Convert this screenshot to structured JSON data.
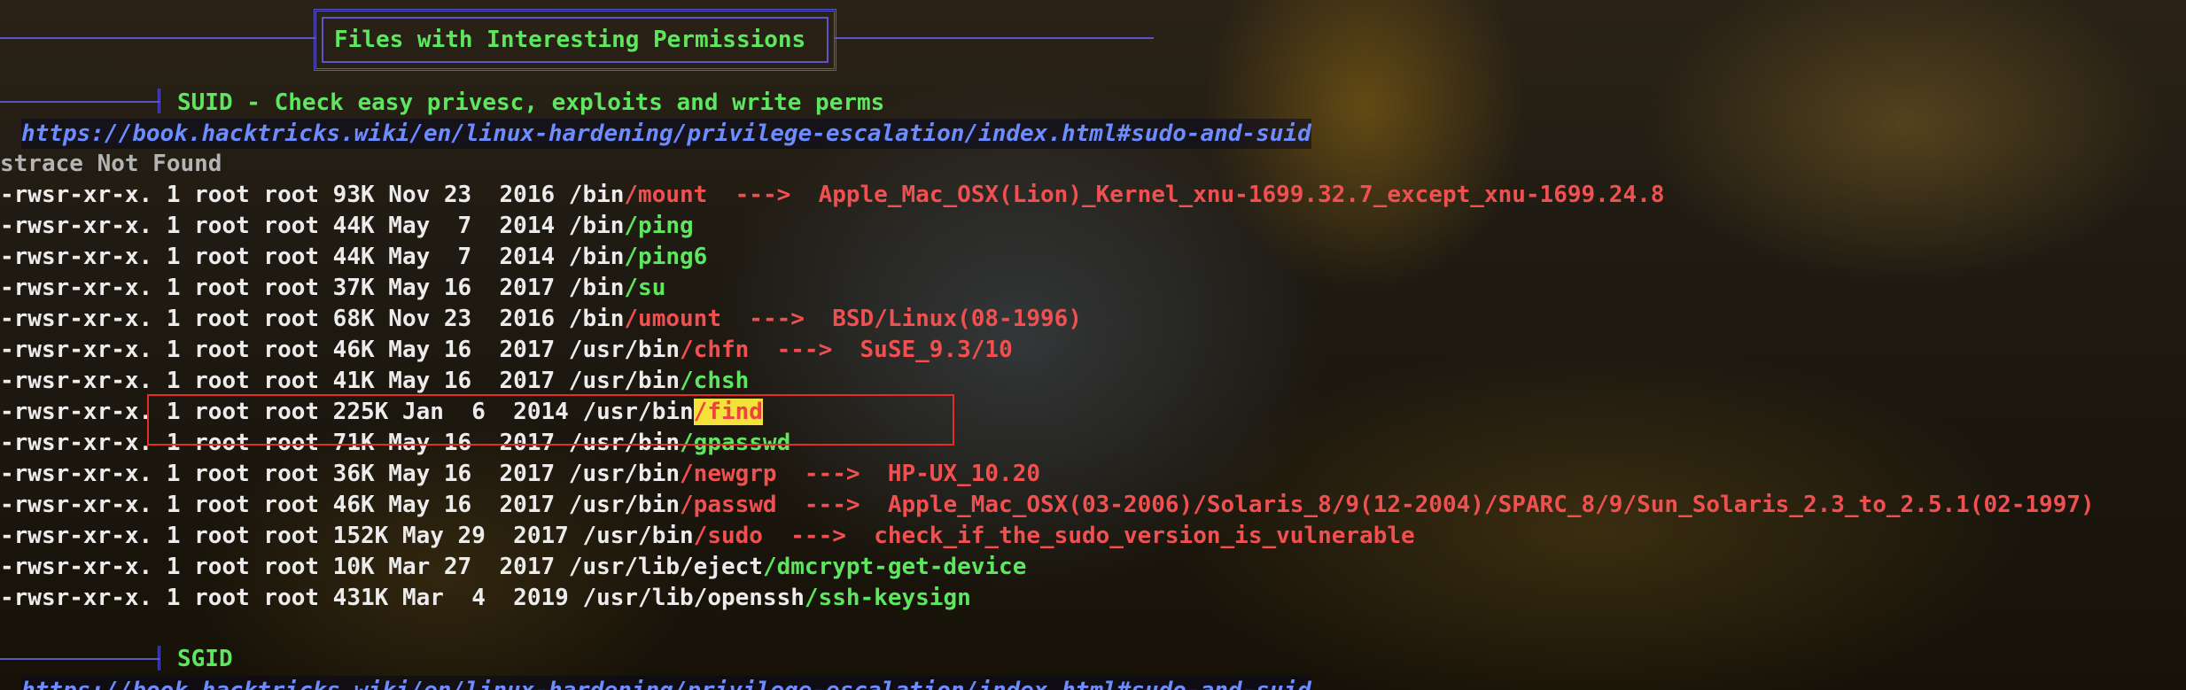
{
  "header": {
    "title": "Files with Interesting Permissions"
  },
  "suid": {
    "heading": "SUID - Check easy privesc, exploits and write perms",
    "link": "https://book.hacktricks.wiki/en/linux-hardening/privilege-escalation/index.html#sudo-and-suid",
    "status": "strace Not Found",
    "rows": [
      {
        "meta": "-rwsr-xr-x. 1 root root 93K Nov 23  2016 /bin",
        "file": "/mount",
        "file_color": "red",
        "arrow": "  --->  ",
        "note": "Apple_Mac_OSX(Lion)_Kernel_xnu-1699.32.7_except_xnu-1699.24.8"
      },
      {
        "meta": "-rwsr-xr-x. 1 root root 44K May  7  2014 /bin",
        "file": "/ping",
        "file_color": "green",
        "arrow": "",
        "note": ""
      },
      {
        "meta": "-rwsr-xr-x. 1 root root 44K May  7  2014 /bin",
        "file": "/ping6",
        "file_color": "green",
        "arrow": "",
        "note": ""
      },
      {
        "meta": "-rwsr-xr-x. 1 root root 37K May 16  2017 /bin",
        "file": "/su",
        "file_color": "green",
        "arrow": "",
        "note": ""
      },
      {
        "meta": "-rwsr-xr-x. 1 root root 68K Nov 23  2016 /bin",
        "file": "/umount",
        "file_color": "red",
        "arrow": "  --->  ",
        "note": "BSD/Linux(08-1996)"
      },
      {
        "meta": "-rwsr-xr-x. 1 root root 46K May 16  2017 /usr/bin",
        "file": "/chfn",
        "file_color": "red",
        "arrow": "  --->  ",
        "note": "SuSE_9.3/10"
      },
      {
        "meta": "-rwsr-xr-x. 1 root root 41K May 16  2017 /usr/bin",
        "file": "/chsh",
        "file_color": "green",
        "arrow": "",
        "note": ""
      },
      {
        "meta": "-rwsr-xr-x. 1 root root 225K Jan  6  2014 /usr/bin",
        "file": "/find",
        "file_color": "highlight",
        "arrow": "",
        "note": ""
      },
      {
        "meta": "-rwsr-xr-x. 1 root root 71K May 16  2017 /usr/bin",
        "file": "/gpasswd",
        "file_color": "green",
        "arrow": "",
        "note": ""
      },
      {
        "meta": "-rwsr-xr-x. 1 root root 36K May 16  2017 /usr/bin",
        "file": "/newgrp",
        "file_color": "red",
        "arrow": "  --->  ",
        "note": "HP-UX_10.20"
      },
      {
        "meta": "-rwsr-xr-x. 1 root root 46K May 16  2017 /usr/bin",
        "file": "/passwd",
        "file_color": "red",
        "arrow": "  --->  ",
        "note": "Apple_Mac_OSX(03-2006)/Solaris_8/9(12-2004)/SPARC_8/9/Sun_Solaris_2.3_to_2.5.1(02-1997)"
      },
      {
        "meta": "-rwsr-xr-x. 1 root root 152K May 29  2017 /usr/bin",
        "file": "/sudo",
        "file_color": "red",
        "arrow": "  --->  ",
        "note": "check_if_the_sudo_version_is_vulnerable"
      },
      {
        "meta": "-rwsr-xr-x. 1 root root 10K Mar 27  2017 /usr/lib/eject",
        "file": "/dmcrypt-get-device",
        "file_color": "green",
        "arrow": "",
        "note": ""
      },
      {
        "meta": "-rwsr-xr-x. 1 root root 431K Mar  4  2019 /usr/lib/openssh",
        "file": "/ssh-keysign",
        "file_color": "green",
        "arrow": "",
        "note": ""
      }
    ]
  },
  "sgid": {
    "heading": "SGID",
    "link": "https://book.hacktricks.wiki/en/linux-hardening/privilege-escalation/index.html#sudo-and-suid"
  }
}
